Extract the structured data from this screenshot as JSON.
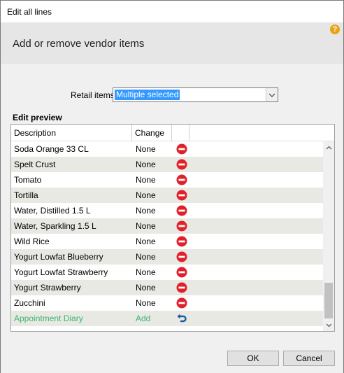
{
  "window": {
    "title": "Edit all lines"
  },
  "header": {
    "title": "Add or remove vendor items",
    "help_glyph": "?"
  },
  "retail": {
    "label": "Retail items",
    "selected_value": "Multiple selected"
  },
  "preview": {
    "label": "Edit preview",
    "columns": {
      "description": "Description",
      "change": "Change"
    },
    "rows": [
      {
        "description": "Soda Orange 33 CL",
        "change": "None",
        "action_icon": "remove-icon"
      },
      {
        "description": "Spelt Crust",
        "change": "None",
        "action_icon": "remove-icon"
      },
      {
        "description": "Tomato",
        "change": "None",
        "action_icon": "remove-icon"
      },
      {
        "description": "Tortilla",
        "change": "None",
        "action_icon": "remove-icon"
      },
      {
        "description": "Water, Distilled 1.5 L",
        "change": "None",
        "action_icon": "remove-icon"
      },
      {
        "description": "Water, Sparkling 1.5 L",
        "change": "None",
        "action_icon": "remove-icon"
      },
      {
        "description": "Wild Rice",
        "change": "None",
        "action_icon": "remove-icon"
      },
      {
        "description": "Yogurt Lowfat Blueberry",
        "change": "None",
        "action_icon": "remove-icon"
      },
      {
        "description": "Yogurt Lowfat Strawberry",
        "change": "None",
        "action_icon": "remove-icon"
      },
      {
        "description": "Yogurt Strawberry",
        "change": "None",
        "action_icon": "remove-icon"
      },
      {
        "description": "Zucchini",
        "change": "None",
        "action_icon": "remove-icon"
      },
      {
        "description": "Appointment Diary",
        "change": "Add",
        "action_icon": "undo-icon"
      }
    ]
  },
  "buttons": {
    "ok": "OK",
    "cancel": "Cancel"
  },
  "colors": {
    "remove_icon": "#e2202a",
    "undo_icon": "#1f5aa6",
    "added_text": "#3cb371",
    "selection": "#3399ff",
    "alt_row": "#e8e9e3"
  }
}
